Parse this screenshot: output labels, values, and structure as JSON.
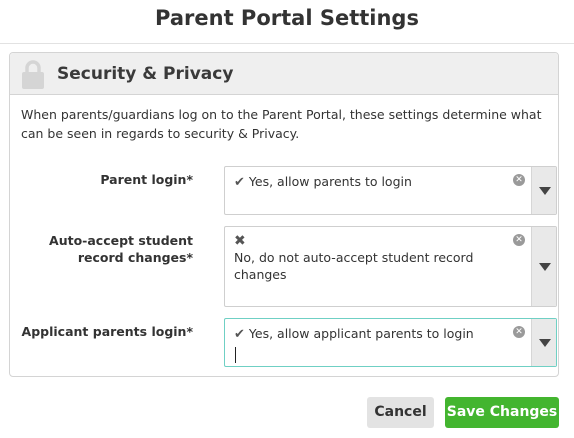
{
  "dialog": {
    "title": "Parent Portal Settings"
  },
  "panel": {
    "title": "Security & Privacy",
    "icon": "lock-icon",
    "description": "When parents/guardians log on to the Parent Portal, these settings determine what can be seen in regards to security & Privacy."
  },
  "fields": {
    "parent_login": {
      "label": "Parent login*",
      "value": "Yes, allow parents to login",
      "value_icon": "check-icon"
    },
    "auto_accept": {
      "label": "Auto-accept student record changes*",
      "value": "No, do not auto-accept student record changes",
      "value_icon": "cross-icon"
    },
    "applicant_login": {
      "label": "Applicant parents login*",
      "value": "Yes, allow applicant parents to login",
      "value_icon": "check-icon"
    }
  },
  "buttons": {
    "cancel": "Cancel",
    "save": "Save Changes"
  },
  "colors": {
    "save_button": "#43b52f",
    "focus_border": "#6fd0c4",
    "panel_header": "#efefef"
  }
}
